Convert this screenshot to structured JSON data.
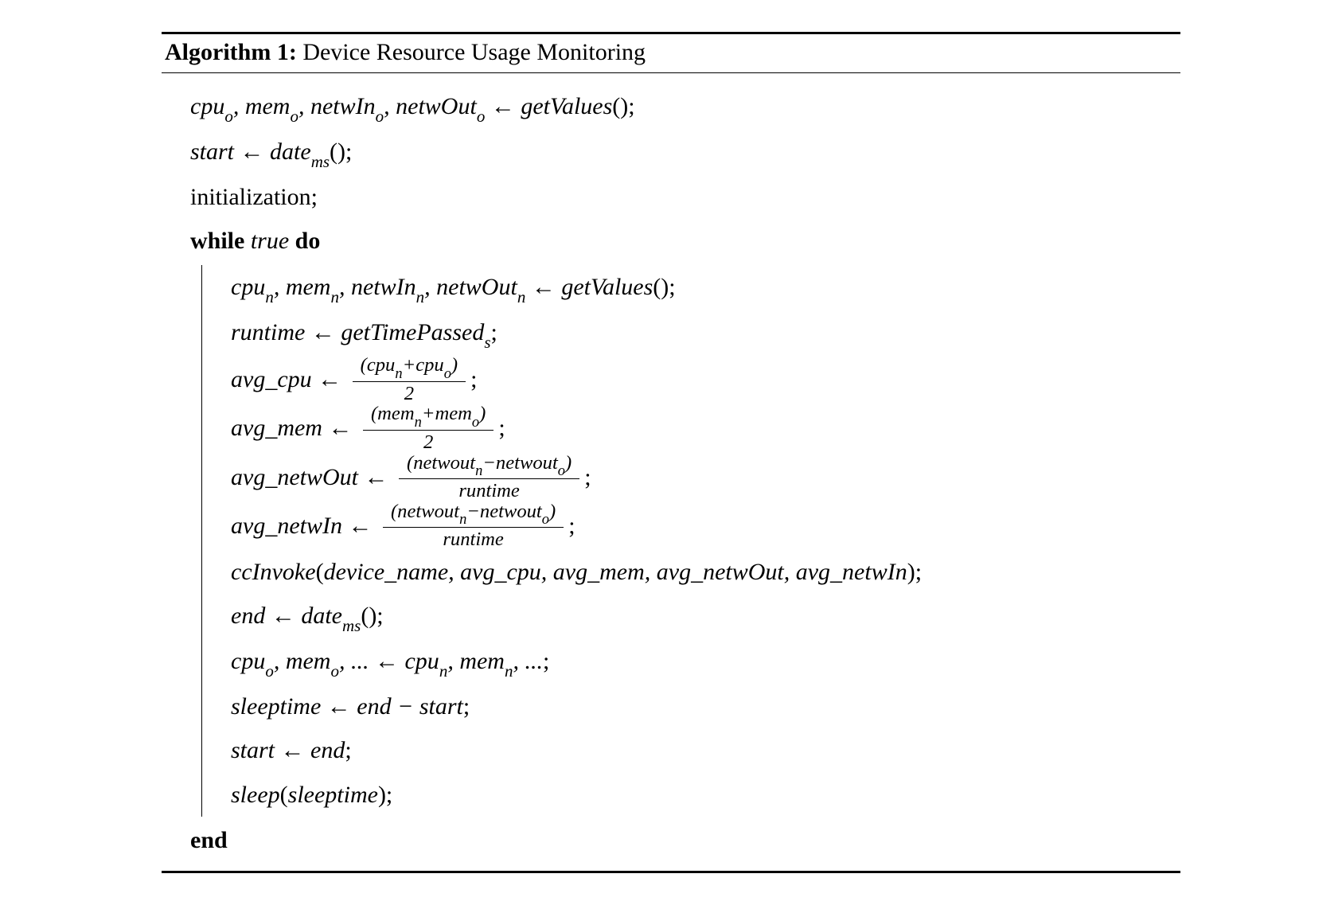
{
  "algorithm": {
    "number": "1",
    "label_prefix": "Algorithm",
    "title": "Device Resource Usage Monitoring",
    "lines": {
      "l1_lhs": "cpu",
      "l1_lhs_sub": "o",
      "l1_lhs2": "mem",
      "l1_lhs3": "netwIn",
      "l1_lhs4": "netwOut",
      "l1_rhs": "getValues",
      "l2_lhs": "start",
      "l2_rhs": "date",
      "l2_rhs_sub": "ms",
      "l3": "initialization;",
      "while_kw": "while",
      "while_cond": "true",
      "do_kw": "do",
      "b1_lhs": "cpu",
      "b1_sub": "n",
      "b1_lhs2": "mem",
      "b1_lhs3": "netwIn",
      "b1_lhs4": "netwOut",
      "b1_rhs": "getValues",
      "b2_lhs": "runtime",
      "b2_rhs": "getTimePassed",
      "b2_rhs_sub": "s",
      "b3_lhs": "avg_cpu",
      "b3_num_a": "cpu",
      "b3_num_b": "cpu",
      "b3_den": "2",
      "b4_lhs": "avg_mem",
      "b4_num_a": "mem",
      "b4_num_b": "mem",
      "b5_lhs": "avg_netwOut",
      "b5_num_a": "netwout",
      "b5_num_b": "netwout",
      "b5_den": "runtime",
      "b6_lhs": "avg_netwIn",
      "b7_fn": "ccInvoke",
      "b7_args": "device_name, avg_cpu, avg_mem, avg_netwOut, avg_netwIn",
      "b8_lhs": "end",
      "b9_lhs1": "cpu",
      "b9_lhs2": "mem",
      "b9_rhs1": "cpu",
      "b9_rhs2": "mem",
      "b10_lhs": "sleeptime",
      "b10_rhs_a": "end",
      "b10_rhs_b": "start",
      "b11_lhs": "start",
      "b11_rhs": "end",
      "b12_fn": "sleep",
      "b12_arg": "sleeptime",
      "end_kw": "end",
      "sub_o": "o",
      "sub_n": "n"
    }
  }
}
